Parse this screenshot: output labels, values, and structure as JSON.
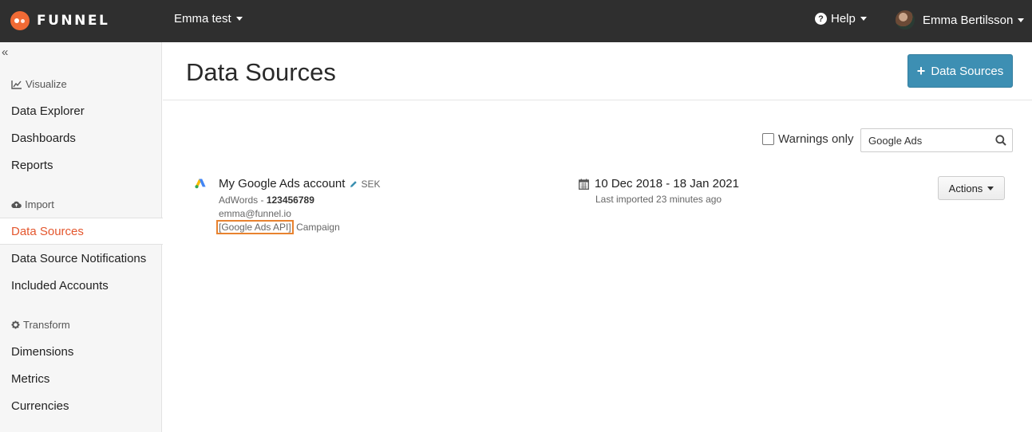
{
  "topbar": {
    "logo_text": "FUNNEL",
    "workspace": "Emma test",
    "help_label": "Help",
    "user_name": "Emma Bertilsson"
  },
  "sidebar": {
    "collapse_glyph": "«",
    "sections": [
      {
        "title": "Visualize",
        "icon": "line-chart-icon",
        "items": [
          "Data Explorer",
          "Dashboards",
          "Reports"
        ]
      },
      {
        "title": "Import",
        "icon": "cloud-upload-icon",
        "items": [
          "Data Sources",
          "Data Source Notifications",
          "Included Accounts"
        ]
      },
      {
        "title": "Transform",
        "icon": "gear-icon",
        "items": [
          "Dimensions",
          "Metrics",
          "Currencies"
        ]
      }
    ],
    "active_item": "Data Sources"
  },
  "page": {
    "title": "Data Sources",
    "add_button_label": "Data Sources",
    "warnings_label": "Warnings only",
    "search_value": "Google Ads"
  },
  "source": {
    "name": "My Google Ads account",
    "currency": "SEK",
    "platform": "AdWords",
    "account_id": "123456789",
    "email": "emma@funnel.io",
    "api_tag": "[Google Ads API]",
    "report_type": "Campaign",
    "date_range": "10 Dec 2018 - 18 Jan 2021",
    "last_imported": "Last imported 23 minutes ago",
    "actions_label": "Actions"
  },
  "colors": {
    "topbar": "#2f2f2f",
    "brand_orange": "#f06a35",
    "active_nav": "#e4572e",
    "primary_button": "#3d8fb3",
    "tag_outline": "#e8822f"
  }
}
